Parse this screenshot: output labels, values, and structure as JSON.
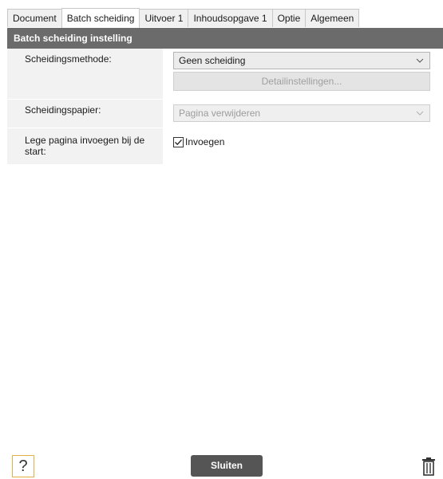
{
  "tabs": [
    "Document",
    "Batch scheiding",
    "Uitvoer 1",
    "Inhoudsopgave 1",
    "Optie",
    "Algemeen"
  ],
  "active_tab": "Batch scheiding",
  "section": {
    "title": "Batch scheiding instelling"
  },
  "rows": {
    "method": {
      "label": "Scheidingsmethode:",
      "value": "Geen scheiding",
      "detail_button": "Detailinstellingen..."
    },
    "paper": {
      "label": "Scheidingspapier:",
      "value": "Pagina verwijderen"
    },
    "blank": {
      "label": "Lege pagina invoegen bij de start:",
      "checkbox_label": "Invoegen",
      "checked": true
    }
  },
  "footer": {
    "help_label": "?",
    "close_label": "Sluiten"
  },
  "icons": {
    "help": "question-icon",
    "trash": "trash-icon",
    "dropdown": "chevron-down-icon"
  },
  "colors": {
    "header_bg": "#6b6b6b",
    "close_bg": "#555555",
    "help_border": "#e3b046"
  }
}
